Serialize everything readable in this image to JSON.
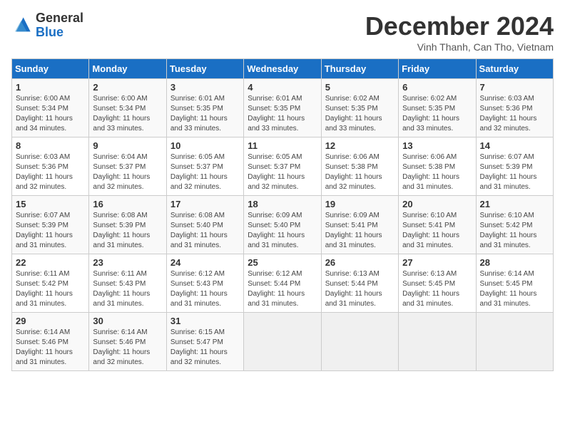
{
  "header": {
    "logo_general": "General",
    "logo_blue": "Blue",
    "month_title": "December 2024",
    "subtitle": "Vinh Thanh, Can Tho, Vietnam"
  },
  "days_of_week": [
    "Sunday",
    "Monday",
    "Tuesday",
    "Wednesday",
    "Thursday",
    "Friday",
    "Saturday"
  ],
  "weeks": [
    [
      {
        "day": "1",
        "sunrise": "Sunrise: 6:00 AM",
        "sunset": "Sunset: 5:34 PM",
        "daylight": "Daylight: 11 hours and 34 minutes."
      },
      {
        "day": "2",
        "sunrise": "Sunrise: 6:00 AM",
        "sunset": "Sunset: 5:34 PM",
        "daylight": "Daylight: 11 hours and 33 minutes."
      },
      {
        "day": "3",
        "sunrise": "Sunrise: 6:01 AM",
        "sunset": "Sunset: 5:35 PM",
        "daylight": "Daylight: 11 hours and 33 minutes."
      },
      {
        "day": "4",
        "sunrise": "Sunrise: 6:01 AM",
        "sunset": "Sunset: 5:35 PM",
        "daylight": "Daylight: 11 hours and 33 minutes."
      },
      {
        "day": "5",
        "sunrise": "Sunrise: 6:02 AM",
        "sunset": "Sunset: 5:35 PM",
        "daylight": "Daylight: 11 hours and 33 minutes."
      },
      {
        "day": "6",
        "sunrise": "Sunrise: 6:02 AM",
        "sunset": "Sunset: 5:35 PM",
        "daylight": "Daylight: 11 hours and 33 minutes."
      },
      {
        "day": "7",
        "sunrise": "Sunrise: 6:03 AM",
        "sunset": "Sunset: 5:36 PM",
        "daylight": "Daylight: 11 hours and 32 minutes."
      }
    ],
    [
      {
        "day": "8",
        "sunrise": "Sunrise: 6:03 AM",
        "sunset": "Sunset: 5:36 PM",
        "daylight": "Daylight: 11 hours and 32 minutes."
      },
      {
        "day": "9",
        "sunrise": "Sunrise: 6:04 AM",
        "sunset": "Sunset: 5:37 PM",
        "daylight": "Daylight: 11 hours and 32 minutes."
      },
      {
        "day": "10",
        "sunrise": "Sunrise: 6:05 AM",
        "sunset": "Sunset: 5:37 PM",
        "daylight": "Daylight: 11 hours and 32 minutes."
      },
      {
        "day": "11",
        "sunrise": "Sunrise: 6:05 AM",
        "sunset": "Sunset: 5:37 PM",
        "daylight": "Daylight: 11 hours and 32 minutes."
      },
      {
        "day": "12",
        "sunrise": "Sunrise: 6:06 AM",
        "sunset": "Sunset: 5:38 PM",
        "daylight": "Daylight: 11 hours and 32 minutes."
      },
      {
        "day": "13",
        "sunrise": "Sunrise: 6:06 AM",
        "sunset": "Sunset: 5:38 PM",
        "daylight": "Daylight: 11 hours and 31 minutes."
      },
      {
        "day": "14",
        "sunrise": "Sunrise: 6:07 AM",
        "sunset": "Sunset: 5:39 PM",
        "daylight": "Daylight: 11 hours and 31 minutes."
      }
    ],
    [
      {
        "day": "15",
        "sunrise": "Sunrise: 6:07 AM",
        "sunset": "Sunset: 5:39 PM",
        "daylight": "Daylight: 11 hours and 31 minutes."
      },
      {
        "day": "16",
        "sunrise": "Sunrise: 6:08 AM",
        "sunset": "Sunset: 5:39 PM",
        "daylight": "Daylight: 11 hours and 31 minutes."
      },
      {
        "day": "17",
        "sunrise": "Sunrise: 6:08 AM",
        "sunset": "Sunset: 5:40 PM",
        "daylight": "Daylight: 11 hours and 31 minutes."
      },
      {
        "day": "18",
        "sunrise": "Sunrise: 6:09 AM",
        "sunset": "Sunset: 5:40 PM",
        "daylight": "Daylight: 11 hours and 31 minutes."
      },
      {
        "day": "19",
        "sunrise": "Sunrise: 6:09 AM",
        "sunset": "Sunset: 5:41 PM",
        "daylight": "Daylight: 11 hours and 31 minutes."
      },
      {
        "day": "20",
        "sunrise": "Sunrise: 6:10 AM",
        "sunset": "Sunset: 5:41 PM",
        "daylight": "Daylight: 11 hours and 31 minutes."
      },
      {
        "day": "21",
        "sunrise": "Sunrise: 6:10 AM",
        "sunset": "Sunset: 5:42 PM",
        "daylight": "Daylight: 11 hours and 31 minutes."
      }
    ],
    [
      {
        "day": "22",
        "sunrise": "Sunrise: 6:11 AM",
        "sunset": "Sunset: 5:42 PM",
        "daylight": "Daylight: 11 hours and 31 minutes."
      },
      {
        "day": "23",
        "sunrise": "Sunrise: 6:11 AM",
        "sunset": "Sunset: 5:43 PM",
        "daylight": "Daylight: 11 hours and 31 minutes."
      },
      {
        "day": "24",
        "sunrise": "Sunrise: 6:12 AM",
        "sunset": "Sunset: 5:43 PM",
        "daylight": "Daylight: 11 hours and 31 minutes."
      },
      {
        "day": "25",
        "sunrise": "Sunrise: 6:12 AM",
        "sunset": "Sunset: 5:44 PM",
        "daylight": "Daylight: 11 hours and 31 minutes."
      },
      {
        "day": "26",
        "sunrise": "Sunrise: 6:13 AM",
        "sunset": "Sunset: 5:44 PM",
        "daylight": "Daylight: 11 hours and 31 minutes."
      },
      {
        "day": "27",
        "sunrise": "Sunrise: 6:13 AM",
        "sunset": "Sunset: 5:45 PM",
        "daylight": "Daylight: 11 hours and 31 minutes."
      },
      {
        "day": "28",
        "sunrise": "Sunrise: 6:14 AM",
        "sunset": "Sunset: 5:45 PM",
        "daylight": "Daylight: 11 hours and 31 minutes."
      }
    ],
    [
      {
        "day": "29",
        "sunrise": "Sunrise: 6:14 AM",
        "sunset": "Sunset: 5:46 PM",
        "daylight": "Daylight: 11 hours and 31 minutes."
      },
      {
        "day": "30",
        "sunrise": "Sunrise: 6:14 AM",
        "sunset": "Sunset: 5:46 PM",
        "daylight": "Daylight: 11 hours and 32 minutes."
      },
      {
        "day": "31",
        "sunrise": "Sunrise: 6:15 AM",
        "sunset": "Sunset: 5:47 PM",
        "daylight": "Daylight: 11 hours and 32 minutes."
      },
      null,
      null,
      null,
      null
    ]
  ]
}
